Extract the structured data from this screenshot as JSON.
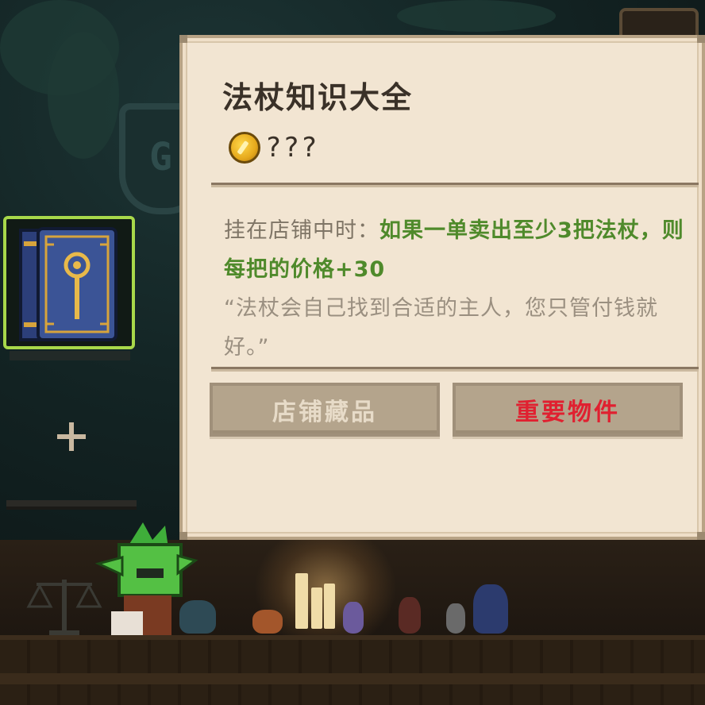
{
  "item": {
    "title": "法杖知识大全",
    "price_icon": "gold-coin-icon",
    "price_text": "???",
    "icon": "staff-book-icon"
  },
  "description": {
    "prefix": "挂在店铺中时：",
    "effect": "如果一单卖出至少3把法杖，则每把的价格+30",
    "quote": "“法杖会自己找到合适的主人，您只管付钱就好。”"
  },
  "buttons": {
    "shop_items": "店铺藏品",
    "key_items": "重要物件"
  },
  "colors": {
    "panel_bg": "#f2e5d2",
    "effect_text": "#4f8a2b",
    "key_items_text": "#e02030",
    "slot_highlight": "#a8d84a",
    "button_bg": "#b4a48c"
  }
}
